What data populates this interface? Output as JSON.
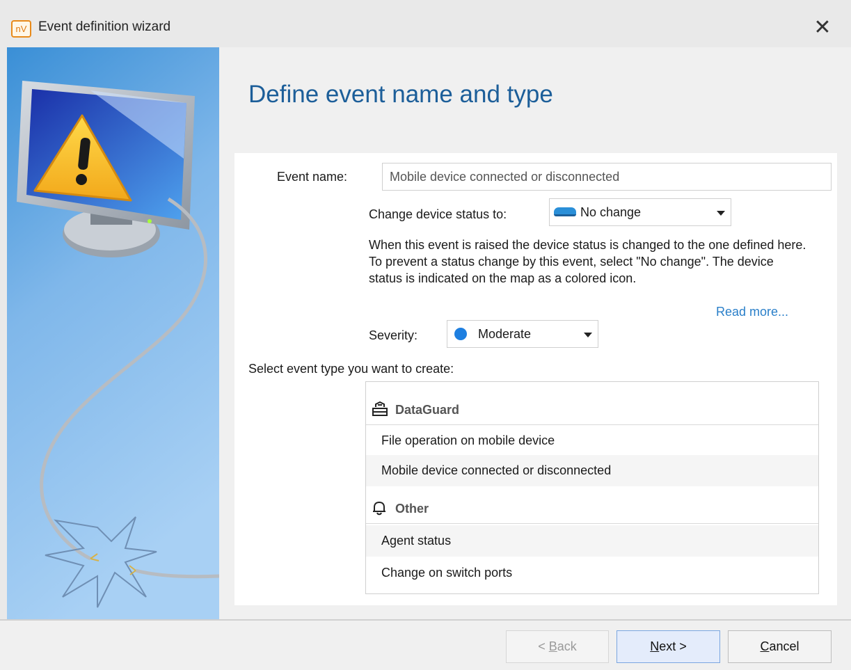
{
  "window": {
    "app_logo": "nV",
    "title": "Event definition wizard",
    "close_label": "✕"
  },
  "main": {
    "page_title": "Define event name and type",
    "event_name": {
      "label": "Event name:",
      "value": "Mobile device connected or disconnected"
    },
    "device_status": {
      "label": "Change device status to:",
      "value": "No change",
      "icon": "device-status-icon",
      "icon_color": "#2a8fd8"
    },
    "description": "When this event is raised  the device status is changed to the one defined here. To prevent a status change by this event, select \"No change\". The device status is indicated on the map as a colored icon.",
    "read_more": "Read more...",
    "severity": {
      "label": "Severity:",
      "value": "Moderate",
      "dot_color": "#1e7fe0"
    },
    "event_type_prompt": "Select event type you want to create:",
    "event_types": {
      "groups": [
        {
          "name": "DataGuard",
          "icon": "dataguard-icon",
          "items": [
            "File operation on mobile device",
            "Mobile device connected or disconnected"
          ]
        },
        {
          "name": "Other",
          "icon": "bell-icon",
          "items": [
            "Agent status",
            "Change on switch ports"
          ]
        }
      ]
    }
  },
  "footer": {
    "back": {
      "prefix": "< ",
      "key": "B",
      "rest": "ack"
    },
    "next": {
      "key": "N",
      "rest": "ext >"
    },
    "cancel": {
      "key": "C",
      "rest": "ancel"
    }
  },
  "colors": {
    "title_blue": "#1c5e99",
    "link_blue": "#2a7fc9",
    "app_orange": "#e88a1a"
  }
}
